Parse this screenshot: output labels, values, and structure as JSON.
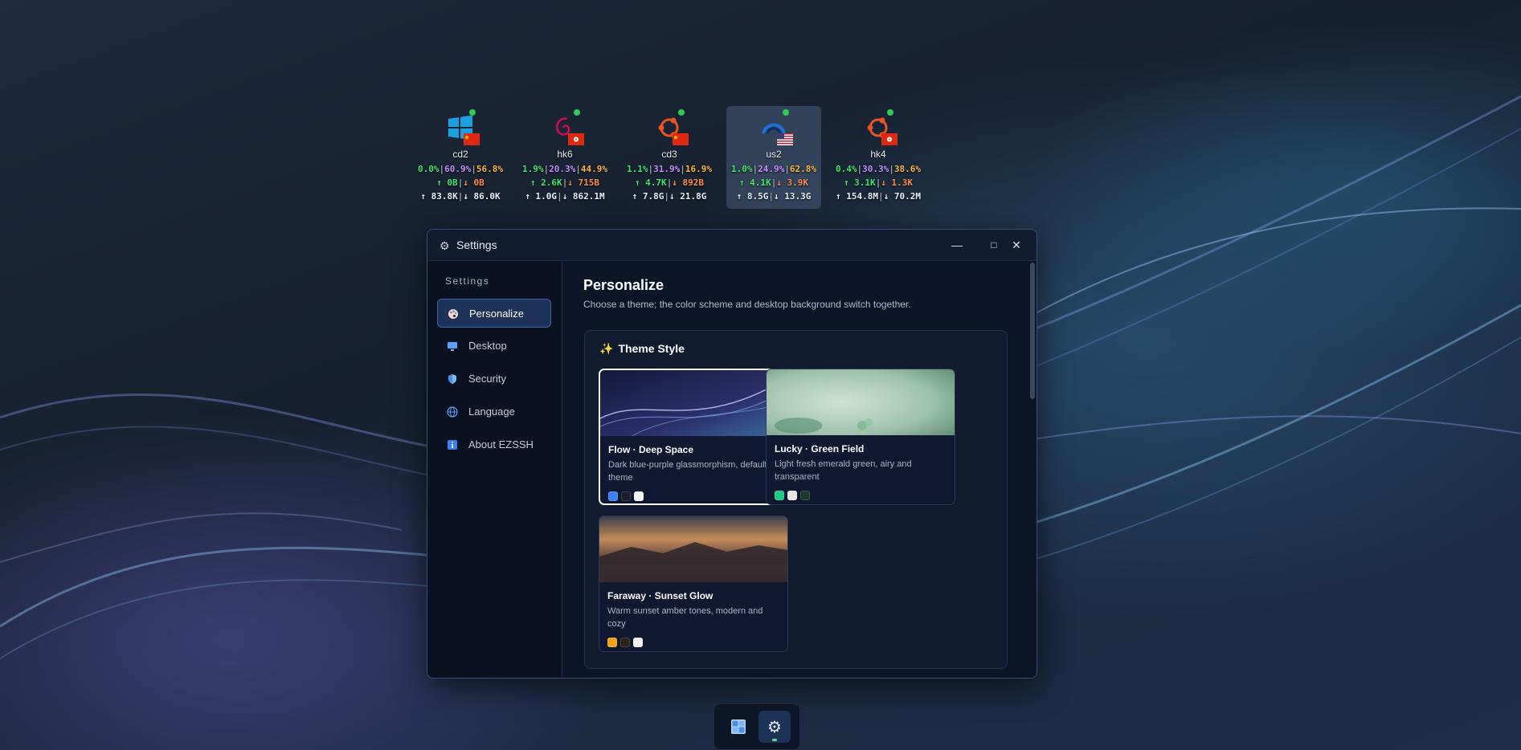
{
  "desktop": {
    "servers": [
      {
        "name": "cd2",
        "os": "windows",
        "flag": "china",
        "cpu": "0.0%",
        "mem": "60.9%",
        "disk": "56.8%",
        "net_up": "↑ 0B",
        "net_down": "↓ 0B",
        "total_up": "↑ 83.8K",
        "total_down": "↓ 86.0K"
      },
      {
        "name": "hk6",
        "os": "debian",
        "flag": "hongkong",
        "cpu": "1.9%",
        "mem": "20.3%",
        "disk": "44.9%",
        "net_up": "↑ 2.6K",
        "net_down": "↓ 715B",
        "total_up": "↑ 1.0G",
        "total_down": "↓ 862.1M"
      },
      {
        "name": "cd3",
        "os": "ubuntu",
        "flag": "china",
        "cpu": "1.1%",
        "mem": "31.9%",
        "disk": "16.9%",
        "net_up": "↑ 4.7K",
        "net_down": "↓ 892B",
        "total_up": "↑ 7.8G",
        "total_down": "↓ 21.8G"
      },
      {
        "name": "us2",
        "os": "almalinux",
        "flag": "usa",
        "cpu": "1.0%",
        "mem": "24.9%",
        "disk": "62.8%",
        "net_up": "↑ 4.1K",
        "net_down": "↓ 3.9K",
        "total_up": "↑ 8.5G",
        "total_down": "↓ 13.3G"
      },
      {
        "name": "hk4",
        "os": "ubuntu",
        "flag": "hongkong",
        "cpu": "0.4%",
        "mem": "30.3%",
        "disk": "38.6%",
        "net_up": "↑ 3.1K",
        "net_down": "↓ 1.3K",
        "total_up": "↑ 154.8M",
        "total_down": "↓ 70.2M"
      }
    ],
    "separator": "|"
  },
  "window": {
    "title": "Settings",
    "controls": {
      "minimize": "—",
      "maximize": "□",
      "close": "✕"
    }
  },
  "sidebar": {
    "title": "Settings",
    "items": [
      {
        "label": "Personalize",
        "icon": "palette-icon"
      },
      {
        "label": "Desktop",
        "icon": "monitor-icon"
      },
      {
        "label": "Security",
        "icon": "shield-icon"
      },
      {
        "label": "Language",
        "icon": "globe-icon"
      },
      {
        "label": "About EZSSH",
        "icon": "info-icon"
      }
    ]
  },
  "content": {
    "title": "Personalize",
    "subtitle": "Choose a theme; the color scheme and desktop background switch together.",
    "section_title": "Theme Style",
    "themes": [
      {
        "name": "Flow · Deep Space",
        "desc": "Dark blue-purple glassmorphism, default theme",
        "selected": true,
        "swatches": [
          "#3b7ff0",
          "#1a1f2e",
          "#f2f2f2"
        ]
      },
      {
        "name": "Lucky · Green Field",
        "desc": "Light fresh emerald green, airy and transparent",
        "selected": false,
        "swatches": [
          "#1fc98a",
          "#e6e6e6",
          "#1c3a2c"
        ]
      },
      {
        "name": "Faraway · Sunset Glow",
        "desc": "Warm sunset amber tones, modern and cozy",
        "selected": false,
        "swatches": [
          "#f2a21e",
          "#2a201c",
          "#f2f2f2"
        ]
      }
    ],
    "check_mark": "✓"
  },
  "taskbar": {
    "items": [
      {
        "name": "desktop-app",
        "icon": "window-icon"
      },
      {
        "name": "settings-app",
        "icon": "gear-icon",
        "active": true
      }
    ]
  }
}
